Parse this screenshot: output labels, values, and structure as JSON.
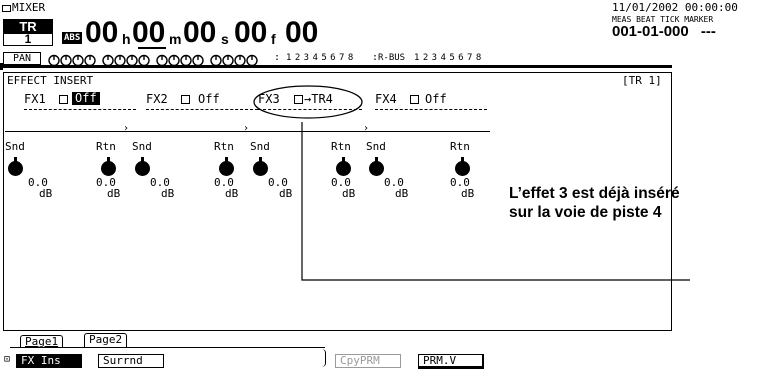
{
  "header": {
    "mixer_label": "MIXER",
    "tr_label": "TR",
    "tr_value": "1",
    "abs_badge": "ABS",
    "timecode": {
      "hours": "00",
      "h_unit": "h",
      "minutes": "00",
      "m_unit": "m",
      "seconds": "00",
      "s_unit": "s",
      "frames": "00",
      "f_unit": "f",
      "subframes": "00"
    },
    "date_time": "11/01/2002 00:00:00",
    "meas_label": "MEAS",
    "beat_label": "BEAT",
    "tick_label": "TICK",
    "marker_label": "MARKER",
    "position": "001-01-000",
    "marker_value": "---"
  },
  "pan_strip": {
    "pan_label": "PAN",
    "track_digits": "1 2 3 4 5 6 7 8",
    "rbus_label": "R-BUS",
    "rbus_digits": "1 2 3 4 5 6 7 8"
  },
  "panel": {
    "title": "EFFECT INSERT",
    "track_tag": "[TR 1]",
    "fx_slots": [
      {
        "name": "FX1",
        "value": "Off",
        "active": true
      },
      {
        "name": "FX2",
        "value": "Off",
        "active": false
      },
      {
        "name": "FX3",
        "value": "→TR4",
        "active": false
      },
      {
        "name": "FX4",
        "value": "Off",
        "active": false
      }
    ],
    "snd_label": "Snd",
    "rtn_label": "Rtn",
    "level_value": "0.0",
    "level_unit": "dB"
  },
  "annotation": {
    "line1": "L’effet 3 est déjà inséré",
    "line2": "sur la voie de piste 4"
  },
  "footer": {
    "tabs": [
      {
        "label": "Page1",
        "active": false
      },
      {
        "label": "Page2",
        "active": true
      }
    ],
    "f_buttons": [
      {
        "label": "FX Ins",
        "style": "inverted"
      },
      {
        "label": "Surrnd",
        "style": "normal"
      },
      {
        "label": "CpyPRM",
        "style": "disabled"
      },
      {
        "label": "PRM.V",
        "style": "normal"
      }
    ]
  }
}
